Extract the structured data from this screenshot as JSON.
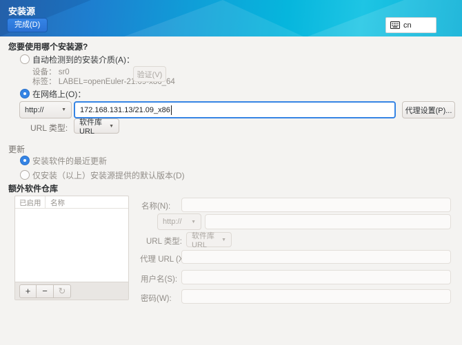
{
  "icons": {
    "chevron_down": "▼",
    "add": "+",
    "remove": "−",
    "refresh": "↻"
  },
  "window": {
    "title": "安装源",
    "done_button": "完成(D)",
    "keyboard_layout": "cn"
  },
  "source_section": {
    "question": "您要使用哪个安装源?",
    "auto_radio_label": "自动检测到的安装介质(A)：",
    "device_label": "设备：",
    "device_value": "sr0",
    "media_label_label": "标签：",
    "media_label_value": "LABEL=openEuler-21.09-x86_64",
    "verify_button": "验证(V)",
    "network_radio_label": "在网络上(O)：",
    "protocol_value": "http://",
    "url_value": "172.168.131.13/21.09_x86",
    "proxy_button": "代理设置(P)...",
    "url_type_label": "URL 类型:",
    "url_type_value": "软件库 URL"
  },
  "updates_section": {
    "title": "更新",
    "latest_radio_label": "安装软件的最近更新",
    "default_radio_label": "仅安装（以上）安装源提供的默认版本(D)"
  },
  "repos_section": {
    "title": "额外软件仓库",
    "table_headers": [
      "已启用",
      "名称"
    ],
    "form": {
      "name_label": "名称(N):",
      "protocol_value": "http://",
      "url_type_label": "URL 类型:",
      "url_type_value": "软件库 URL",
      "proxy_url_label": "代理 URL (X)：",
      "username_label": "用户名(S):",
      "password_label": "密码(W):"
    }
  }
}
